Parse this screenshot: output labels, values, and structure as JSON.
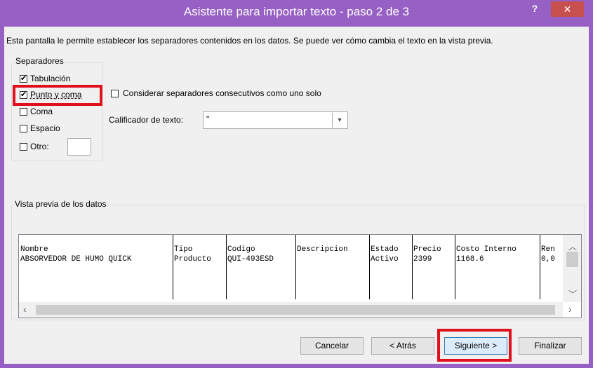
{
  "window": {
    "title": "Asistente para importar texto - paso 2 de 3",
    "help": "?",
    "close": "✕"
  },
  "description": "Esta pantalla le permite establecer los separadores contenidos en los datos. Se puede ver cómo cambia el texto en la vista previa.",
  "separators": {
    "title": "Separadores",
    "tab": "Tabulación",
    "semicolon": "Punto y coma",
    "comma": "Coma",
    "space": "Espacio",
    "other": "Otro:",
    "other_value": ""
  },
  "consecutive": "Considerar separadores consecutivos como uno solo",
  "qualifier": {
    "label": "Calificador de texto:",
    "value": "\""
  },
  "preview": {
    "title": "Vista previa de los datos",
    "columns": [
      {
        "header": "Nombre",
        "value": "ABSORVEDOR DE HUMO QUICK"
      },
      {
        "header": "Tipo",
        "value": "Producto"
      },
      {
        "header": "Codigo",
        "value": "QUI-493ESD"
      },
      {
        "header": "Descripcion",
        "value": ""
      },
      {
        "header": "Estado",
        "value": "Activo"
      },
      {
        "header": "Precio",
        "value": "2399"
      },
      {
        "header": "Costo Interno",
        "value": "1168.6"
      },
      {
        "header": "Ren",
        "value": "0,0"
      }
    ]
  },
  "buttons": {
    "cancel": "Cancelar",
    "back": "< Atrás",
    "next": "Siguiente >",
    "finish": "Finalizar"
  },
  "colors": {
    "titlebar": "#9660c4",
    "close": "#c7504f",
    "highlight": "#e0101d"
  }
}
